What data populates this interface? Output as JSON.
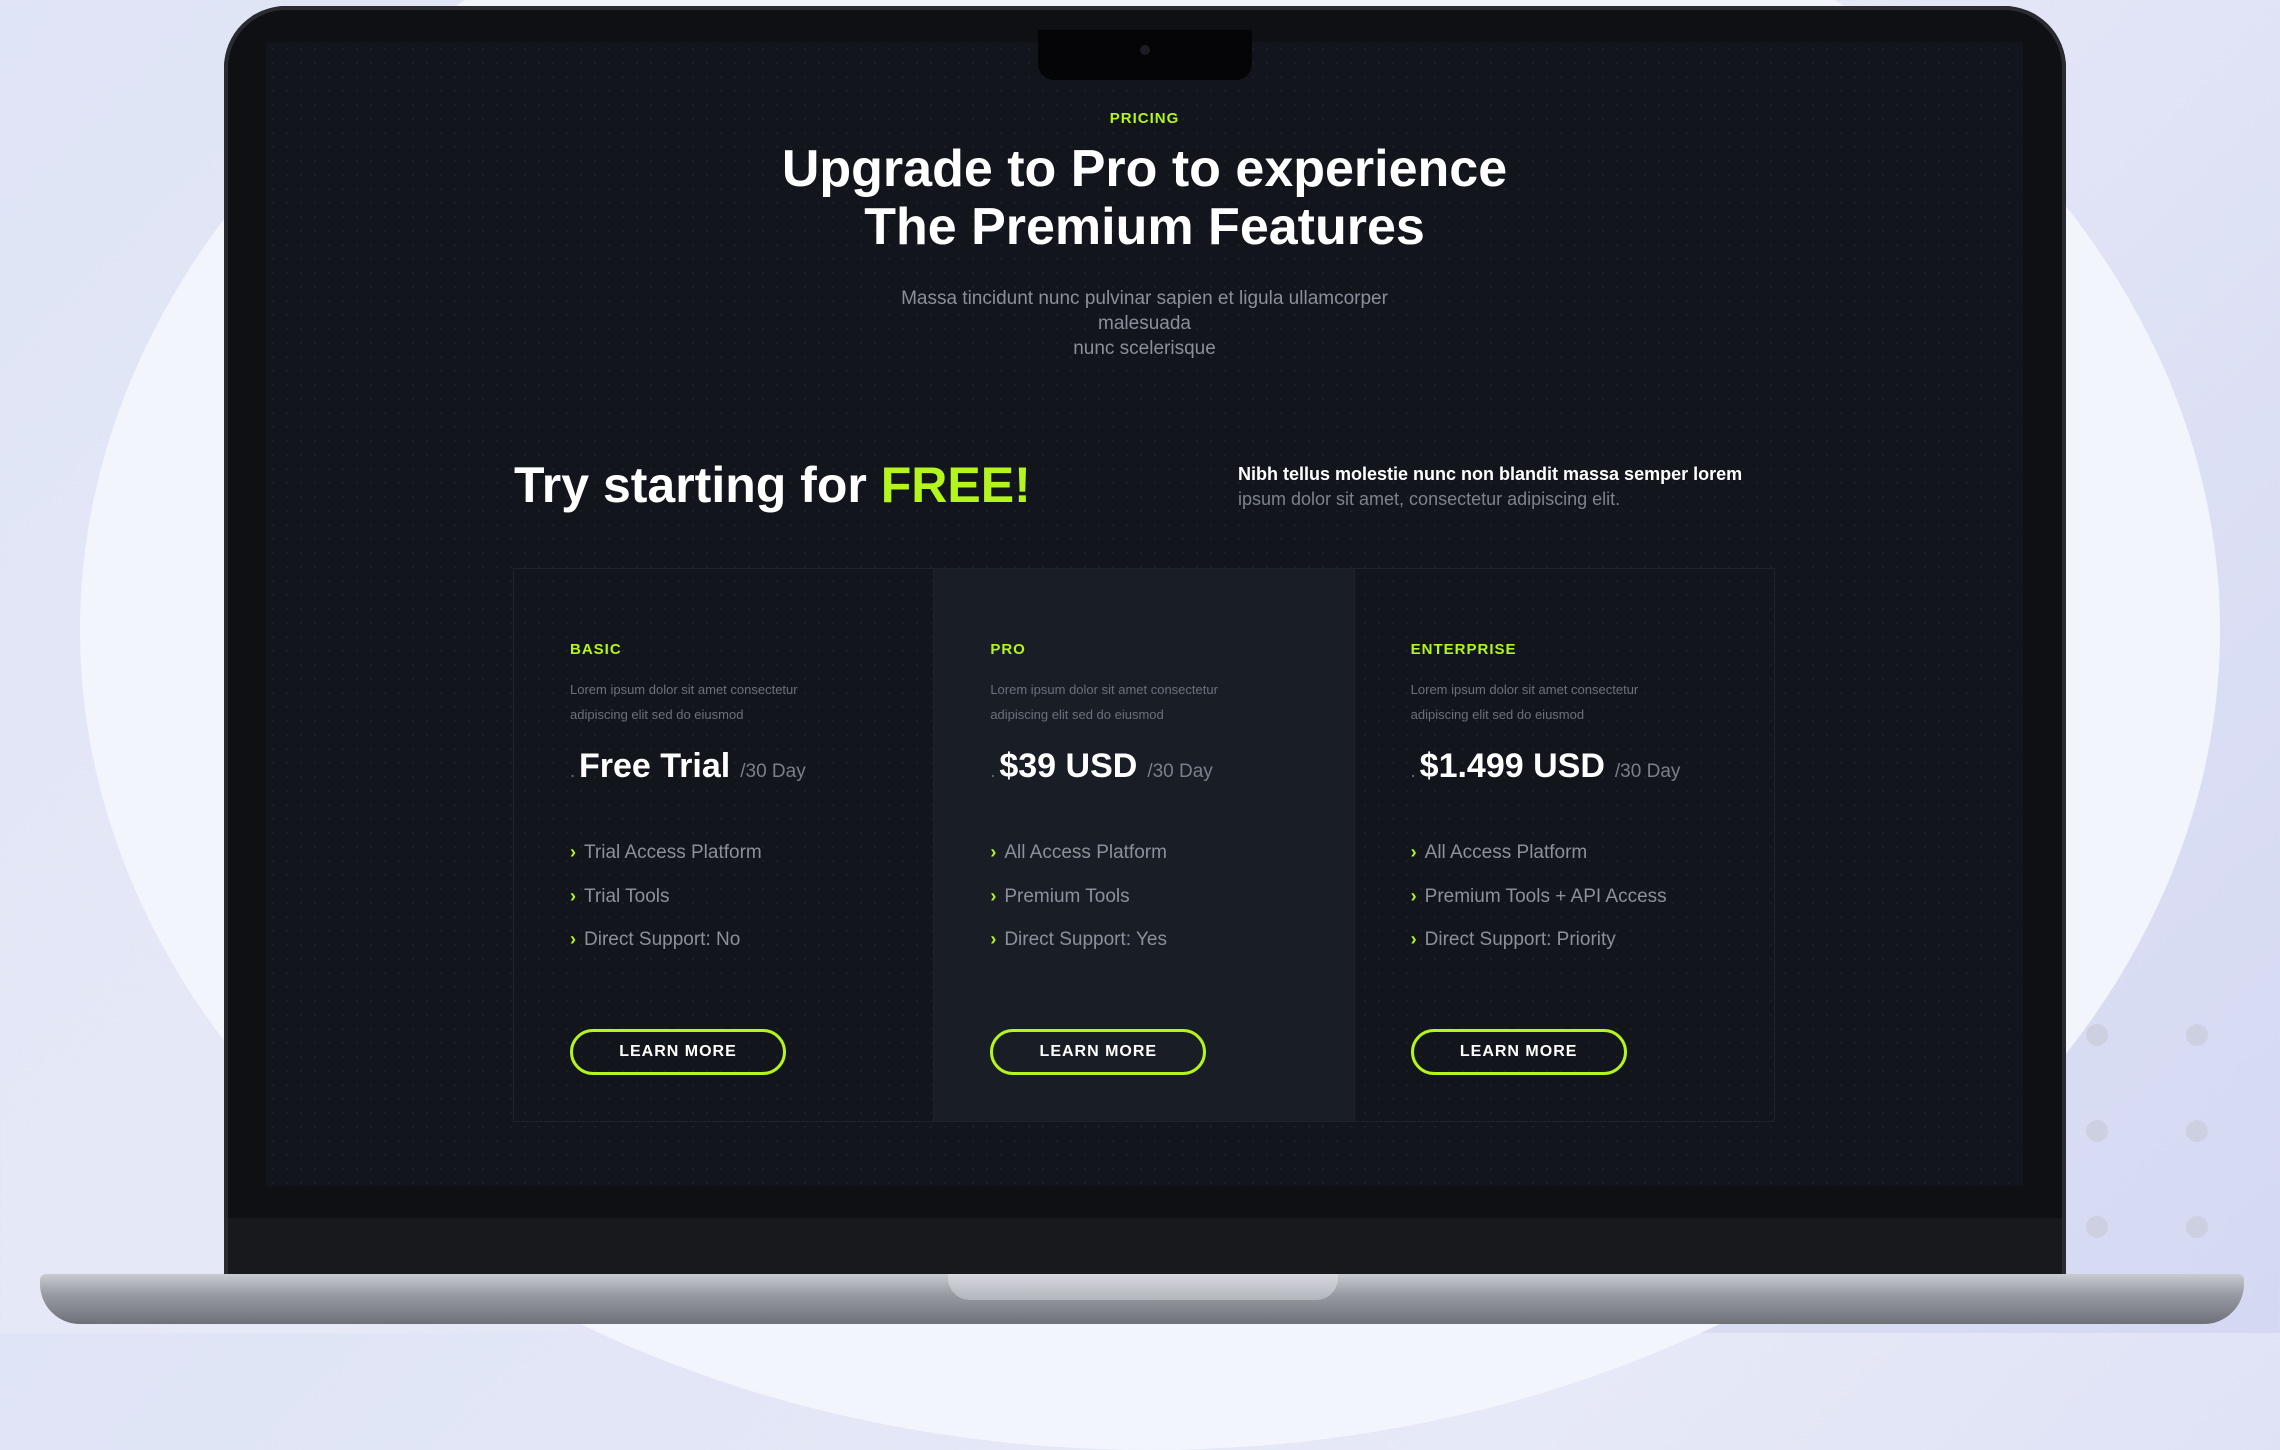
{
  "colors": {
    "accent": "#b4f51d",
    "screen_bg": "#12151c",
    "featured_card_bg": "#191d25",
    "text_primary": "#ffffff",
    "text_muted": "#8a8f99"
  },
  "header": {
    "eyebrow": "PRICING",
    "title_line1": "Upgrade to Pro to experience",
    "title_line2": "The Premium Features",
    "subtitle_line1": "Massa tincidunt nunc pulvinar sapien et ligula ullamcorper",
    "subtitle_line2": "malesuada",
    "subtitle_line3": "nunc scelerisque"
  },
  "promo": {
    "prefix": "Try starting for ",
    "highlight": "FREE!",
    "note_strong": "Nibh tellus molestie nunc non blandit massa semper lorem",
    "note_soft": "ipsum dolor sit amet, consectetur adipiscing elit."
  },
  "plans": [
    {
      "name": "BASIC",
      "desc_line1": "Lorem ipsum dolor sit amet consectetur",
      "desc_line2": "adipiscing elit sed do eiusmod",
      "marker": ".",
      "price": "Free Trial",
      "period": "/30 Day",
      "features": [
        "Trial Access Platform",
        "Trial Tools",
        "Direct Support: No"
      ],
      "chevron_icon": "chevron-right-icon",
      "button": "LEARN MORE"
    },
    {
      "name": "PRO",
      "desc_line1": "Lorem ipsum dolor sit amet consectetur",
      "desc_line2": "adipiscing elit sed do eiusmod",
      "marker": ".",
      "price": "$39 USD",
      "period": "/30 Day",
      "features": [
        "All Access Platform",
        "Premium Tools",
        "Direct Support: Yes"
      ],
      "chevron_icon": "chevron-right-icon",
      "button": "LEARN MORE"
    },
    {
      "name": "ENTERPRISE",
      "desc_line1": "Lorem ipsum dolor sit amet consectetur",
      "desc_line2": "adipiscing elit sed do eiusmod",
      "marker": ".",
      "price": "$1.499 USD",
      "period": "/30 Day",
      "features": [
        "All Access Platform",
        "Premium Tools + API Access",
        "Direct Support: Priority"
      ],
      "chevron_icon": "chevron-right-icon",
      "button": "LEARN MORE"
    }
  ]
}
